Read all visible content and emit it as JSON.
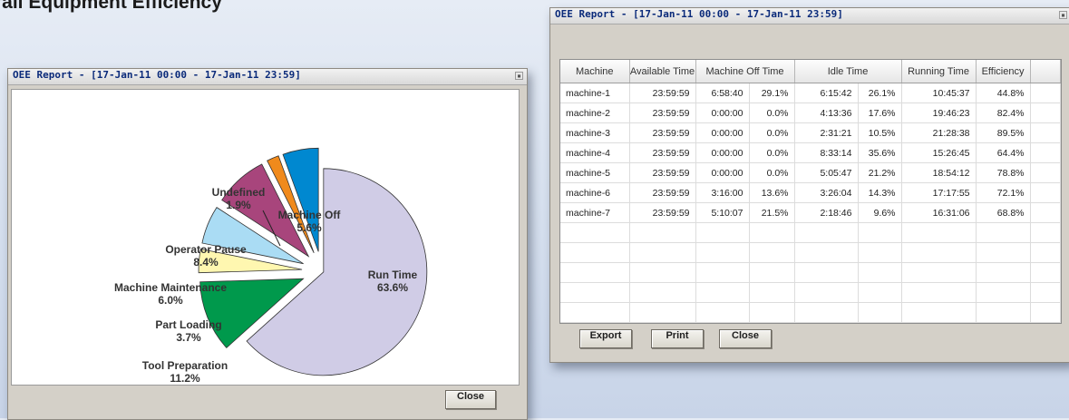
{
  "page": {
    "heading": "rall Equipment Efficiency"
  },
  "chart_window": {
    "title": "OEE Report - [17-Jan-11 00:00 - 17-Jan-11 23:59]",
    "close_label": "Close"
  },
  "table_window": {
    "title": "OEE Report - [17-Jan-11 00:00 - 17-Jan-11 23:59]",
    "buttons": {
      "export": "Export",
      "print": "Print",
      "close": "Close"
    },
    "columns": [
      "Machine",
      "Available Time",
      "Machine Off Time",
      "Idle Time",
      "Running Time",
      "Efficiency"
    ],
    "rows": [
      [
        "machine-1",
        "23:59:59",
        "6:58:40",
        "29.1%",
        "6:15:42",
        "26.1%",
        "10:45:37",
        "44.8%"
      ],
      [
        "machine-2",
        "23:59:59",
        "0:00:00",
        "0.0%",
        "4:13:36",
        "17.6%",
        "19:46:23",
        "82.4%"
      ],
      [
        "machine-3",
        "23:59:59",
        "0:00:00",
        "0.0%",
        "2:31:21",
        "10.5%",
        "21:28:38",
        "89.5%"
      ],
      [
        "machine-4",
        "23:59:59",
        "0:00:00",
        "0.0%",
        "8:33:14",
        "35.6%",
        "15:26:45",
        "64.4%"
      ],
      [
        "machine-5",
        "23:59:59",
        "0:00:00",
        "0.0%",
        "5:05:47",
        "21.2%",
        "18:54:12",
        "78.8%"
      ],
      [
        "machine-6",
        "23:59:59",
        "3:16:00",
        "13.6%",
        "3:26:04",
        "14.3%",
        "17:17:55",
        "72.1%"
      ],
      [
        "machine-7",
        "23:59:59",
        "5:10:07",
        "21.5%",
        "2:18:46",
        "9.6%",
        "16:31:06",
        "68.8%"
      ]
    ]
  },
  "chart_data": {
    "type": "pie",
    "series": [
      {
        "label": "Run Time",
        "value": 63.6,
        "color": "#d0cce6"
      },
      {
        "label": "Tool Preparation",
        "value": 11.2,
        "color": "#00994c"
      },
      {
        "label": "Part Loading",
        "value": 3.7,
        "color": "#fff7b0"
      },
      {
        "label": "Machine Maintenance",
        "value": 6.0,
        "color": "#aadcf4"
      },
      {
        "label": "Operator Pause",
        "value": 8.4,
        "color": "#a8457c"
      },
      {
        "label": "Undefined",
        "value": 1.9,
        "color": "#f08a1c"
      },
      {
        "label": "Machine Off",
        "value": 5.6,
        "color": "#0088d0"
      }
    ],
    "value_labels": [
      "63.6%",
      "11.2%",
      "3.7%",
      "6.0%",
      "8.4%",
      "1.9%",
      "5.6%"
    ]
  }
}
